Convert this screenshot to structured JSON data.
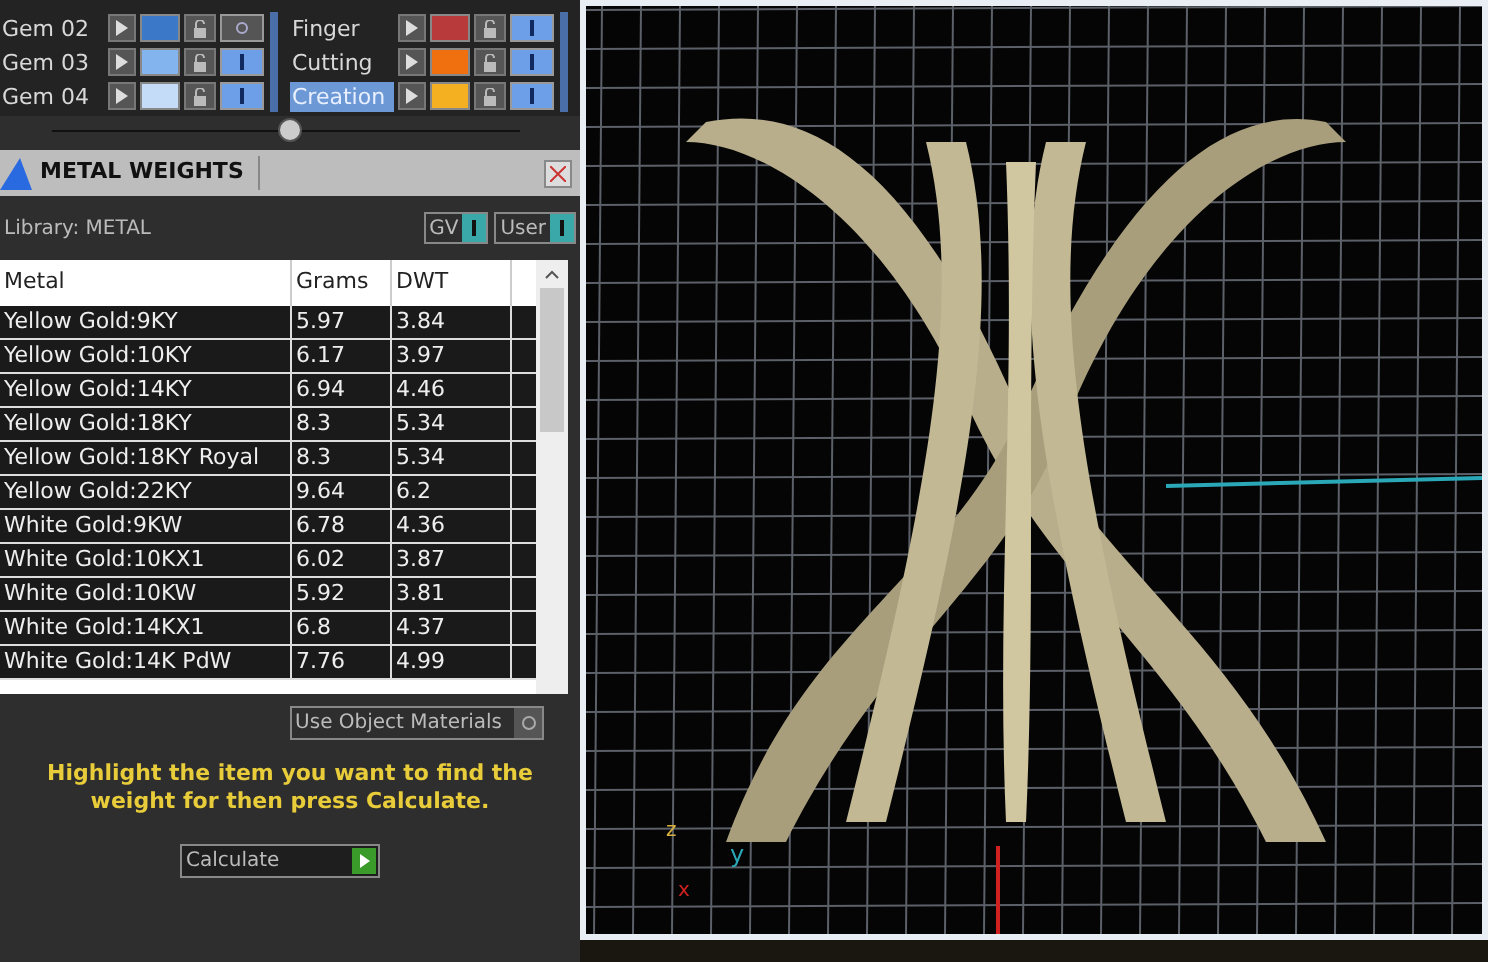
{
  "layers": {
    "left": [
      {
        "name": "Gem 02",
        "color": "#3b78c8",
        "visible": false,
        "selected": false
      },
      {
        "name": "Gem 03",
        "color": "#84b4ee",
        "visible": true,
        "selected": false
      },
      {
        "name": "Gem 04",
        "color": "#c4dcf8",
        "visible": true,
        "selected": false
      }
    ],
    "right": [
      {
        "name": "Finger",
        "color": "#b83a3a",
        "visible": true,
        "selected": false
      },
      {
        "name": "Cutting",
        "color": "#f07010",
        "visible": true,
        "selected": false
      },
      {
        "name": "Creation",
        "color": "#f4b020",
        "visible": true,
        "selected": true
      }
    ]
  },
  "panel": {
    "title": "METAL WEIGHTS",
    "library": "Library: METAL",
    "toggles": [
      {
        "label": "GV",
        "on": true
      },
      {
        "label": "User",
        "on": true
      }
    ]
  },
  "table": {
    "columns": [
      "Metal",
      "Grams",
      "DWT"
    ],
    "rows": [
      {
        "metal": "Yellow Gold:9KY",
        "grams": "5.97",
        "dwt": "3.84"
      },
      {
        "metal": "Yellow Gold:10KY",
        "grams": "6.17",
        "dwt": "3.97"
      },
      {
        "metal": "Yellow Gold:14KY",
        "grams": "6.94",
        "dwt": "4.46"
      },
      {
        "metal": "Yellow Gold:18KY",
        "grams": "8.3",
        "dwt": "5.34"
      },
      {
        "metal": "Yellow Gold:18KY Royal",
        "grams": "8.3",
        "dwt": "5.34"
      },
      {
        "metal": "Yellow Gold:22KY",
        "grams": "9.64",
        "dwt": "6.2"
      },
      {
        "metal": "White Gold:9KW",
        "grams": "6.78",
        "dwt": "4.36"
      },
      {
        "metal": "White Gold:10KX1",
        "grams": "6.02",
        "dwt": "3.87"
      },
      {
        "metal": "White Gold:10KW",
        "grams": "5.92",
        "dwt": "3.81"
      },
      {
        "metal": "White Gold:14KX1",
        "grams": "6.8",
        "dwt": "4.37"
      },
      {
        "metal": "White Gold:14K PdW",
        "grams": "7.76",
        "dwt": "4.99"
      }
    ]
  },
  "use_object_materials": {
    "label": "Use Object Materials",
    "checked": false
  },
  "hint": "Highlight the item you want to find the weight for then press Calculate.",
  "calculate": "Calculate",
  "viewport": {
    "axes": [
      "z",
      "y",
      "x"
    ]
  }
}
